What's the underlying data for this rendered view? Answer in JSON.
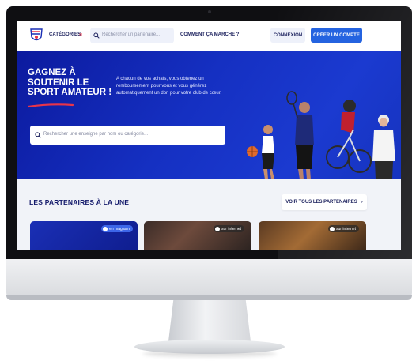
{
  "nav": {
    "categories_label": "CATÉGORIES",
    "search_placeholder": "Rechercher un partenaire...",
    "how_it_works": "COMMENT ÇA MARCHE ?",
    "login": "CONNEXION",
    "signup": "CRÉER UN COMPTE"
  },
  "hero": {
    "title": "GAGNEZ À SOUTENIR LE SPORT AMATEUR !",
    "text": "A chacun de vos achats, vous obtenez un remboursement pour vous et vous générez automatiquement un don pour votre club de cœur.",
    "search_placeholder": "Rechercher une enseigne par nom ou catégorie..."
  },
  "partners": {
    "title": "LES PARTENAIRES À LA UNE",
    "see_all": "VOIR TOUS LES PARTENAIRES",
    "cards": [
      {
        "badge": "en magasin"
      },
      {
        "badge": "sur internet"
      },
      {
        "badge": "sur internet"
      }
    ]
  },
  "colors": {
    "primary_blue": "#2463e0",
    "hero_blue": "#1530c2",
    "navy_text": "#1a1f5c",
    "accent_red": "#e8344a"
  }
}
